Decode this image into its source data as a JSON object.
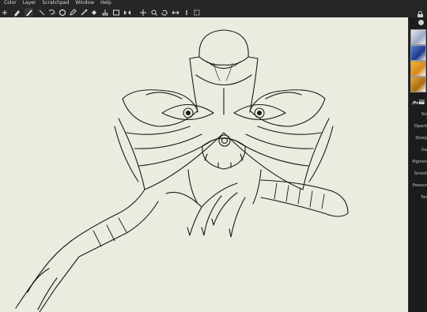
{
  "menu": [
    "Color",
    "Layer",
    "Scratchpad",
    "Window",
    "Help"
  ],
  "toolbar": {
    "tools": [
      "plus-icon",
      "eraser-icon",
      "brush-icon",
      "line-icon",
      "lasso-icon",
      "rotate-icon",
      "pen-icon",
      "eyedropper-icon",
      "fill-icon",
      "stamp-icon",
      "rectangle-icon",
      "symmetry-icon",
      "move-icon",
      "zoom-icon",
      "rotate-view-icon",
      "flip-icon",
      "info-icon",
      "fit-icon"
    ]
  },
  "dock": {
    "panel_title": "Free",
    "properties": [
      "Siz",
      "Opacit",
      "Sharp",
      "Ga",
      "Pigmen",
      "Smoot",
      "Pressur",
      "Twi"
    ]
  },
  "colors": {
    "canvas": "#ecebe0",
    "chrome": "#262626",
    "ink": "#1a1a1a"
  }
}
